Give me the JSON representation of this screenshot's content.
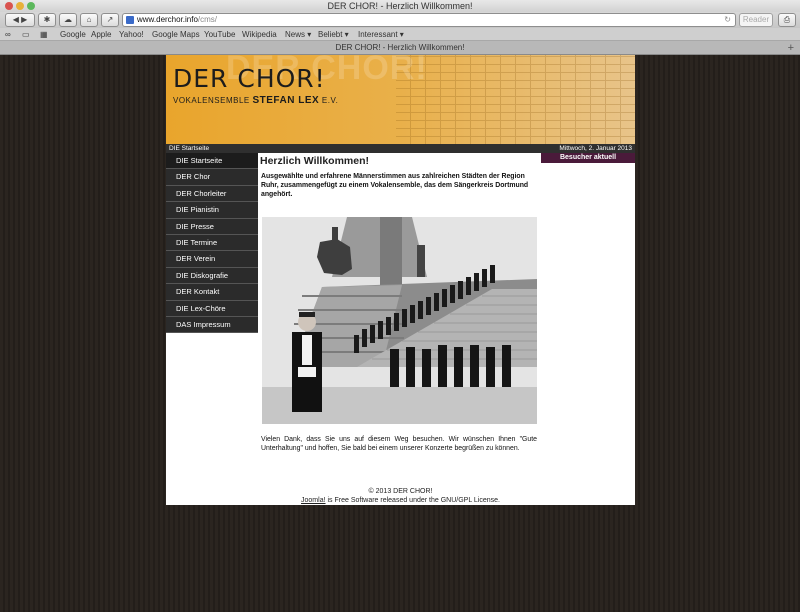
{
  "browser": {
    "window_title": "DER CHOR! - Herzlich Willkommen!",
    "url_host": "www.derchor.info",
    "url_path": "/cms/",
    "reader_label": "Reader",
    "bookmarks": [
      "Google",
      "Apple",
      "Yahoo!",
      "Google Maps",
      "YouTube",
      "Wikipedia",
      "News ▾",
      "Beliebt ▾",
      "Interessant ▾"
    ],
    "tab_title": "DER CHOR! - Herzlich Willkommen!",
    "new_tab": "+"
  },
  "banner": {
    "title": "DER CHOR!",
    "subtitle_prefix": "VOKALENSEMBLE",
    "subtitle_name": "STEFAN LEX",
    "subtitle_suffix": "E.V."
  },
  "infobar": {
    "breadcrumb": "DIE Startseite",
    "date": "Mittwoch, 2. Januar 2013"
  },
  "menu": [
    {
      "label": "DIE Startseite"
    },
    {
      "label": "DER Chor"
    },
    {
      "label": "DER Chorleiter"
    },
    {
      "label": "DIE Pianistin"
    },
    {
      "label": "DIE Presse"
    },
    {
      "label": "DIE Termine"
    },
    {
      "label": "DER Verein"
    },
    {
      "label": "DIE Diskografie"
    },
    {
      "label": "DER Kontakt"
    },
    {
      "label": "DIE Lex-Chöre"
    },
    {
      "label": "DAS Impressum"
    }
  ],
  "content": {
    "heading": "Herzlich Willkommen!",
    "intro": "Ausgewählte und erfahrene Männerstimmen aus zahlreichen Städten der Region Ruhr, zusammengefügt zu einem Vokalensemble, das dem Sängerkreis Dortmund angehört.",
    "thanks": "Vielen Dank, dass Sie uns auf diesem Weg besuchen. Wir wünschen Ihnen \"Gute Unterhaltung\" und hoffen, Sie bald bei einem unserer Konzerte begrüßen zu können."
  },
  "sidebar": {
    "visitors_title": "Besucher aktuell"
  },
  "footer": {
    "copyright": "© 2013 DER CHOR!",
    "joomla_link": "Joomla!",
    "license_text": " is Free Software released under the GNU/GPL License."
  }
}
